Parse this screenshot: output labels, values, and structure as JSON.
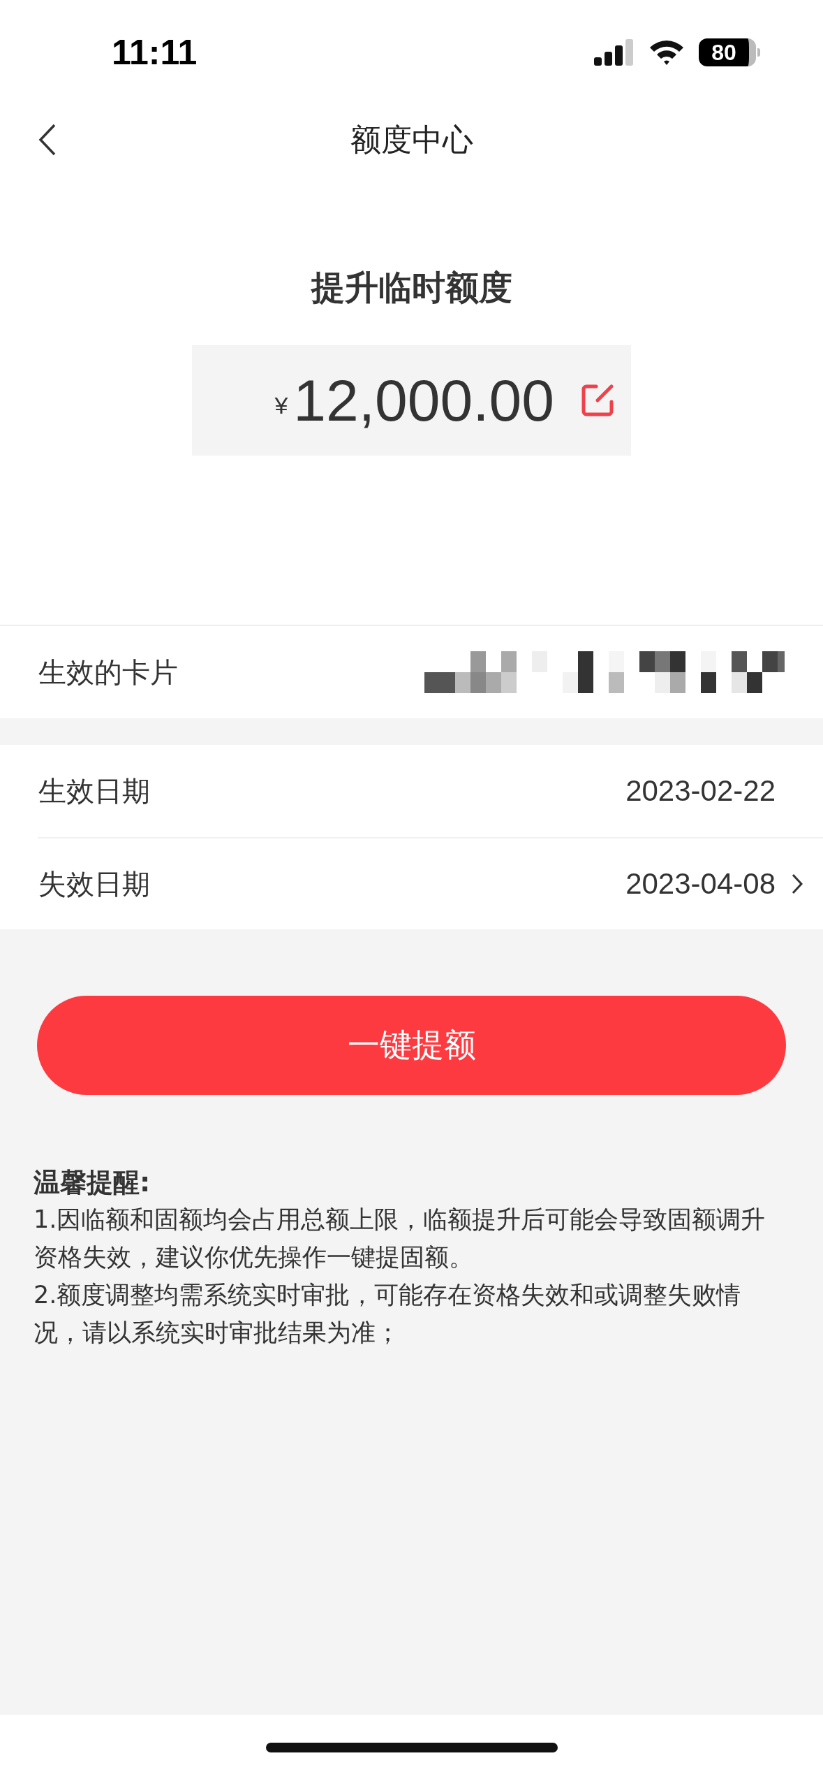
{
  "status_bar": {
    "time": "11:11",
    "battery": "80"
  },
  "nav": {
    "title": "额度中心"
  },
  "limit": {
    "heading": "提升临时额度",
    "currency": "¥",
    "amount": "12,000.00"
  },
  "card_row": {
    "label": "生效的卡片"
  },
  "date_rows": [
    {
      "label": "生效日期",
      "value": "2023-02-22",
      "kind": "plain"
    },
    {
      "label": "失效日期",
      "value": "2023-04-08",
      "kind": "link"
    }
  ],
  "button": "一键提额",
  "notice": {
    "title": "温馨提醒:",
    "items": [
      "1.因临额和固额均会占用总额上限，临额提升后可能会导致固额调升资格失效，建议你优先操作一键提固额。",
      "2.额度调整均需系统实时审批，可能存在资格失效和或调整失败情况，请以系统实时审批结果为准；"
    ]
  }
}
